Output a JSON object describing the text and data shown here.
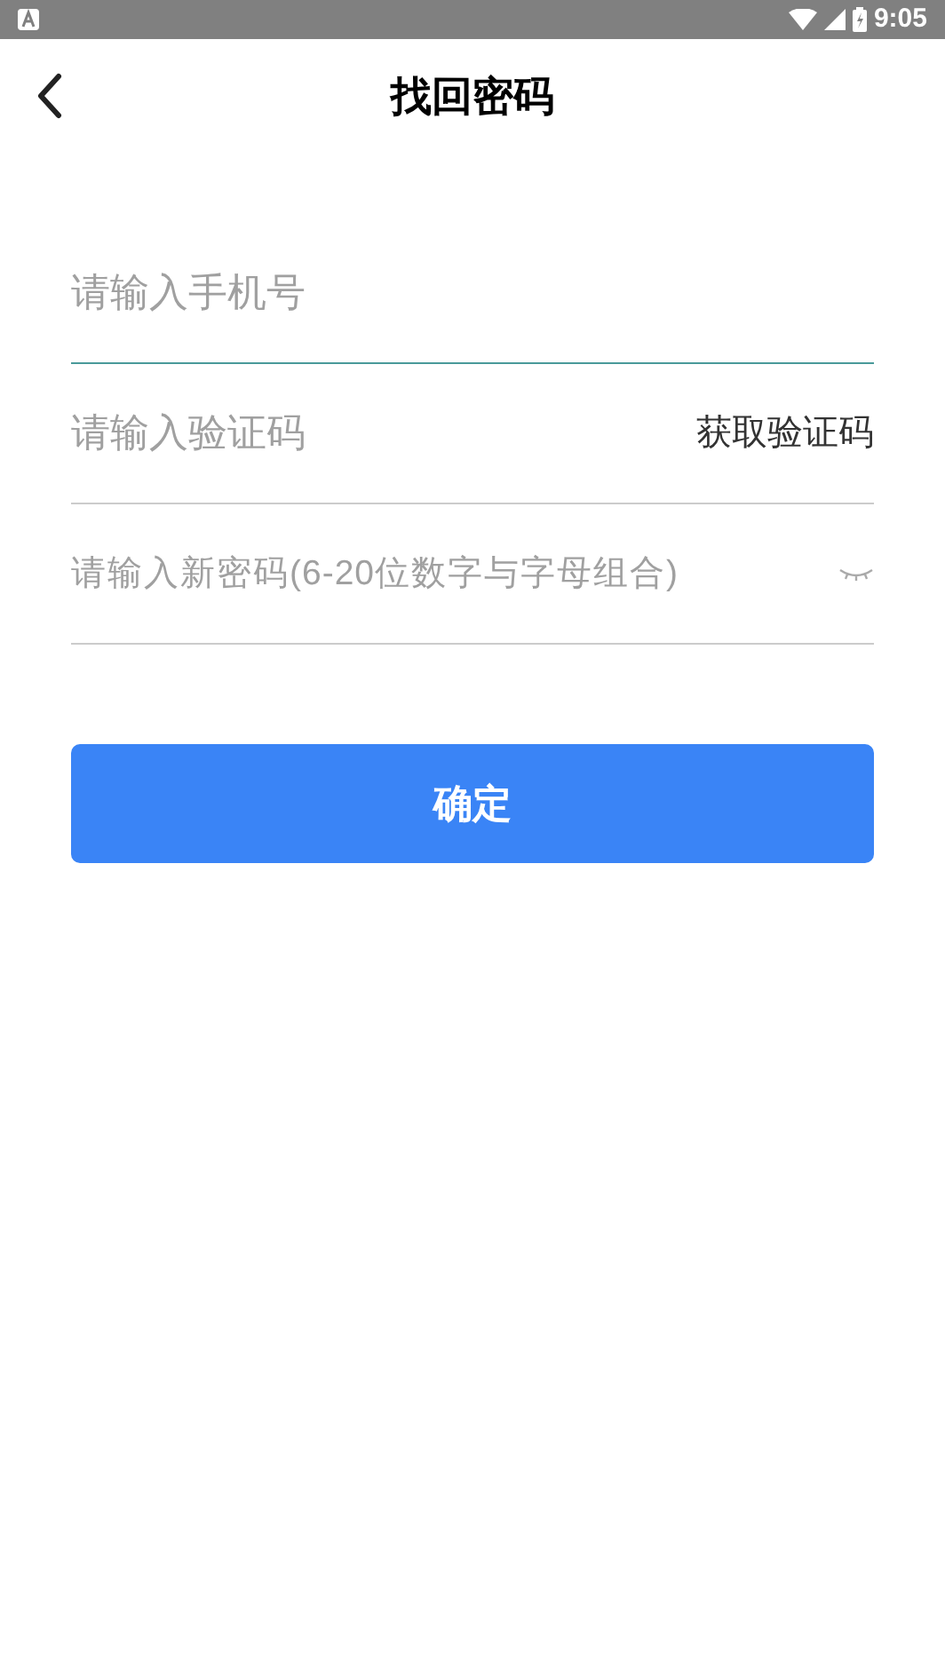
{
  "status_bar": {
    "time": "9:05"
  },
  "header": {
    "title": "找回密码"
  },
  "fields": [
    {
      "kind": "phone",
      "placeholder": "请输入手机号",
      "focused": true
    },
    {
      "kind": "code",
      "placeholder": "请输入验证码",
      "focused": false,
      "action": "获取验证码"
    },
    {
      "kind": "password",
      "placeholder": "请输入新密码(6-20位数字与字母组合)",
      "focused": false
    }
  ],
  "submit_button": {
    "label": "确定"
  }
}
